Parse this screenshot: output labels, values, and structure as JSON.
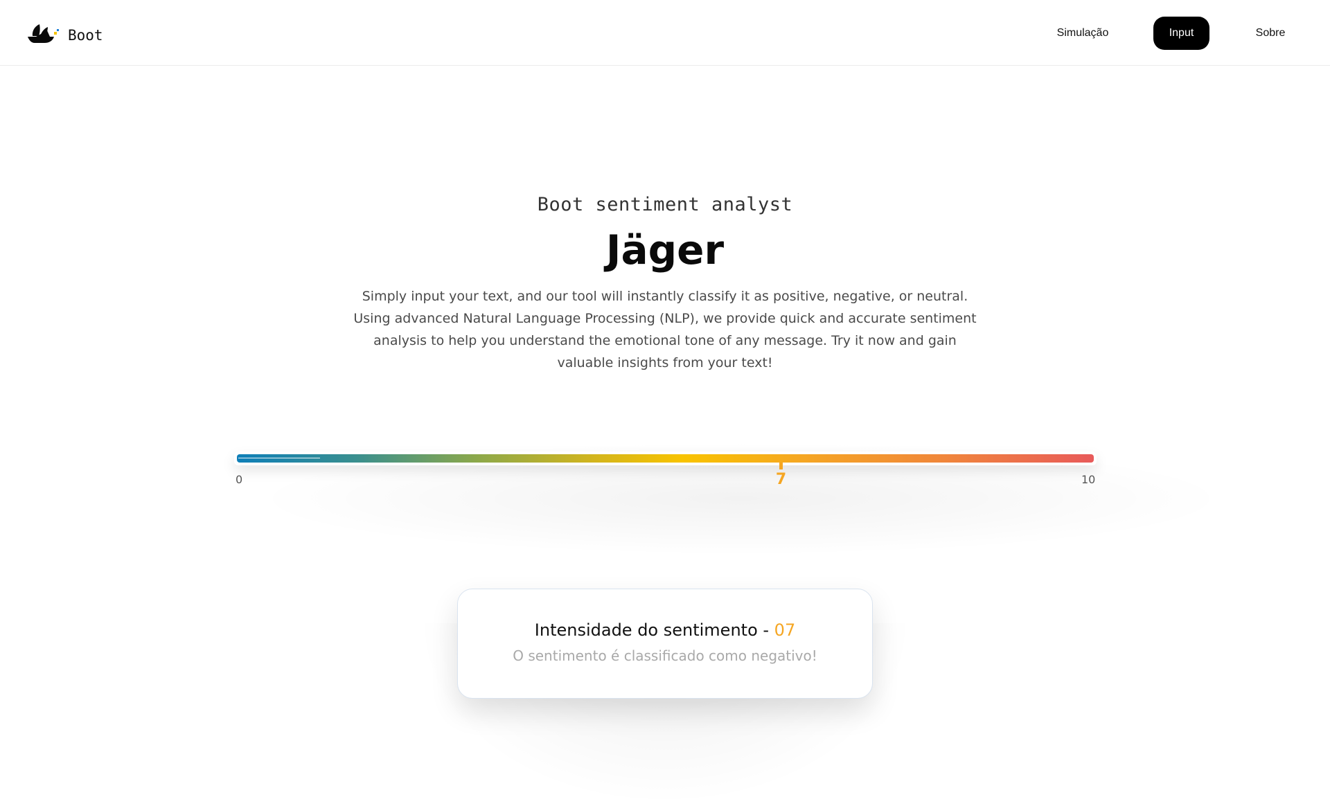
{
  "header": {
    "brand_name": "Boot",
    "nav": [
      {
        "label": "Simulação",
        "active": false
      },
      {
        "label": "Input",
        "active": true
      },
      {
        "label": "Sobre",
        "active": false
      }
    ]
  },
  "hero": {
    "subtitle": "Boot sentiment analyst",
    "title": "Jäger",
    "description": "Simply input your text, and our tool will instantly classify it as positive, negative, or neutral. Using advanced Natural Language Processing (NLP), we provide quick and accurate sentiment analysis to help you understand the emotional tone of any message. Try it now and gain valuable insights from your text!"
  },
  "gauge": {
    "min_label": "0",
    "max_label": "10",
    "value_label": "7",
    "value": 6.35,
    "min": 0,
    "max": 10,
    "gradient_colors": [
      "#0f7fb8",
      "#8ca84a",
      "#f8c300",
      "#f5a623",
      "#e85a5a"
    ],
    "marker_color": "#f5a623"
  },
  "result": {
    "title_prefix": "Intensidade do sentimento - ",
    "score": "07",
    "classification": "O sentimento é classificado como negativo!"
  },
  "colors": {
    "accent": "#f5a623",
    "nav_active_bg": "#000000"
  }
}
